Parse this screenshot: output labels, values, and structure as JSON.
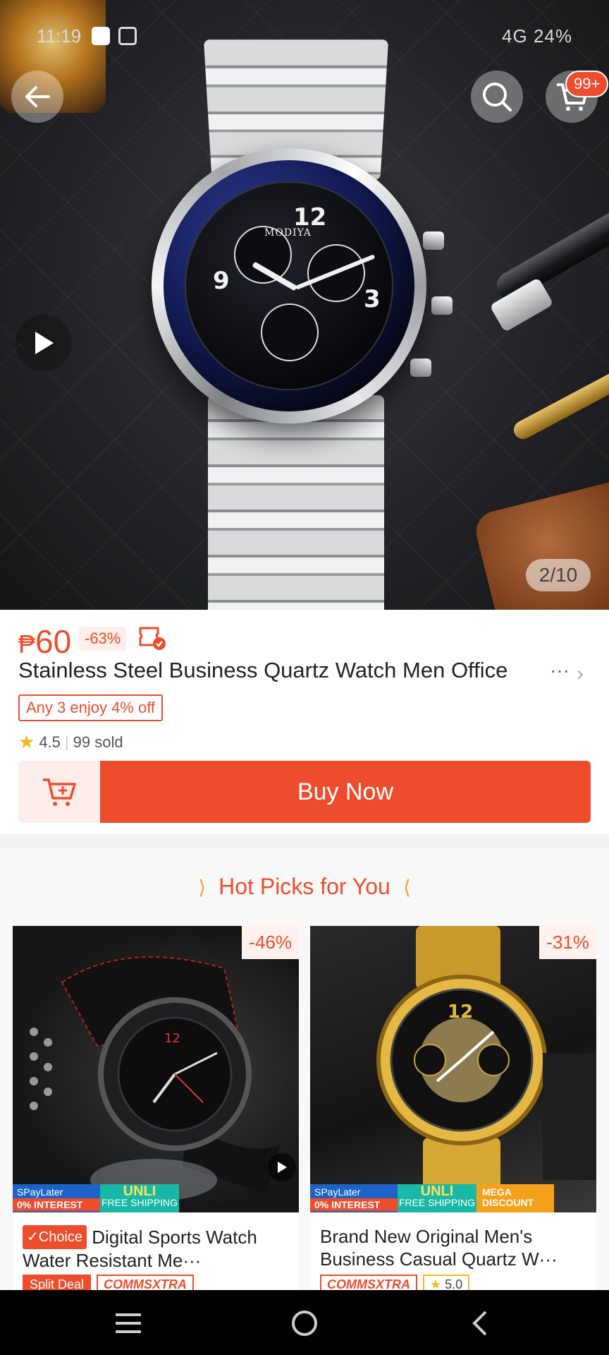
{
  "status_bar": {
    "time": "11:19",
    "right_text": "4G 24%",
    "icons": [
      "app-notification-icon",
      "calendar-icon",
      "alarm-icon",
      "vibrate-icon",
      "signal-icon",
      "battery-icon"
    ]
  },
  "header": {
    "back_icon": "arrow-left-icon",
    "search_icon": "search-icon",
    "cart_icon": "cart-icon",
    "cart_badge": "99+"
  },
  "gallery": {
    "counter": "2/10",
    "play_icon": "play-icon",
    "watch_brand_text": "MODIYA"
  },
  "product": {
    "currency": "₱",
    "price": "60",
    "discount": "-63%",
    "title": "Stainless Steel Business Quartz Watch Men Office",
    "title_more": "···",
    "promo": "Any 3 enjoy 4% off",
    "rating": "4.5",
    "sold": "99 sold",
    "buy_now": "Buy Now"
  },
  "hot_picks": {
    "title": "Hot Picks for You",
    "items": [
      {
        "discount": "-46%",
        "badge": "✓Choice",
        "name": "Digital Sports Watch Water Resistant Me···",
        "strip": {
          "spay": "SPayLater",
          "interest": "0% INTEREST",
          "unli": "UNLI",
          "unli_sub": "FREE SHIPPING"
        },
        "tags": [
          "Split Deal",
          "COMMSXTRA"
        ]
      },
      {
        "discount": "-31%",
        "name": "Brand New Original Men's Business Casual Quartz W···",
        "strip": {
          "spay": "SPayLater",
          "interest": "0% INTEREST",
          "unli": "UNLI",
          "unli_sub": "FREE SHIPPING",
          "mega": "MEGA DISCOUNT"
        },
        "tags": [
          "COMMSXTRA",
          "5.0"
        ]
      }
    ]
  },
  "navbar": {
    "icons": [
      "menu-icon",
      "home-icon",
      "back-icon"
    ]
  },
  "colors": {
    "accent": "#ee4d2d",
    "star": "#f8b81f"
  }
}
